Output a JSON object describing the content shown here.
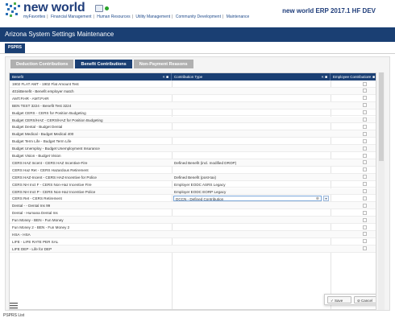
{
  "brand": {
    "name": "new world",
    "version": "new world ERP 2017.1 HF DEV"
  },
  "topnav": [
    "myFavorites",
    "Financial Management",
    "Human Resources",
    "Utility Management",
    "Community Development",
    "Maintenance"
  ],
  "page_title": "Arizona System Settings Maintenance",
  "subtab": "PSPRS",
  "tabs": [
    {
      "label": "Deduction Contributions",
      "active": false
    },
    {
      "label": "Benefit Contributions",
      "active": true
    },
    {
      "label": "Non-Payment Reasons",
      "active": false
    }
  ],
  "columns": [
    "Benefit",
    "Contribution Type",
    "Employee Contribution"
  ],
  "rows": [
    {
      "benefit": "1902 FLAT AMT - 1902 Flat Amount Test",
      "type": ""
    },
    {
      "benefit": "401kBenefit - Benefit employer match",
      "type": ""
    },
    {
      "benefit": "AMT.P.HR - AMT.P.HR",
      "type": ""
    },
    {
      "benefit": "BEN TEST 3224 - Benefit Test 3224",
      "type": ""
    },
    {
      "benefit": "Budget CERS - CERS for Position Budgeting",
      "type": ""
    },
    {
      "benefit": "Budget CERS/HAZ - CERS/HAZ for Position Budgeting",
      "type": ""
    },
    {
      "benefit": "Budget Dental - Budget Dental",
      "type": ""
    },
    {
      "benefit": "Budget Medical - Budget Medical 400",
      "type": ""
    },
    {
      "benefit": "Budget Term Life - Budget Term Life",
      "type": ""
    },
    {
      "benefit": "Budget Unemploy - Budget Unemployment Insurance",
      "type": ""
    },
    {
      "benefit": "Budget Vision - Budget Vision",
      "type": ""
    },
    {
      "benefit": "CERS HAZ Incent - CERS HAZ Incentive-Fire",
      "type": "Defined Benefit (incl. modified DROP)"
    },
    {
      "benefit": "CERS Haz Ret - CERS Hazardous Retirement",
      "type": ""
    },
    {
      "benefit": "CERS HAZ-Incent - CERS HAZ-Incentive for Police",
      "type": "Defined Benefit (post-tax)"
    },
    {
      "benefit": "CERS NH Inct F - CERS Non-Haz Incentive Fire",
      "type": "Employer EODC ASRS Legacy"
    },
    {
      "benefit": "CERS NH Inct P - CERS Non-Haz Incentive Police",
      "type": "Employer EODC EORP Legacy"
    },
    {
      "benefit": "CERS Ret - CERS Retirement",
      "type": "DCCN - Defined Contribution",
      "editing": true
    },
    {
      "benefit": "Dental - - Dental Ins 99",
      "type": ""
    },
    {
      "benefit": "Dental - Humana Dental Ins",
      "type": ""
    },
    {
      "benefit": "Fun Money - BEN - Fun Money",
      "type": ""
    },
    {
      "benefit": "Fun Money 2 - BEN - Fun Money 2",
      "type": ""
    },
    {
      "benefit": "HSA - HSA",
      "type": ""
    },
    {
      "benefit": "LIFE - LIFE RATE PER SAL",
      "type": ""
    },
    {
      "benefit": "LIFE DEP - Life for DEP",
      "type": ""
    }
  ],
  "actions": {
    "save": "Save",
    "cancel": "Cancel"
  },
  "footer": {
    "label": "PSPRS List"
  },
  "colors": {
    "primary": "#1a3f73",
    "tab_inactive": "#b0b0b0"
  }
}
